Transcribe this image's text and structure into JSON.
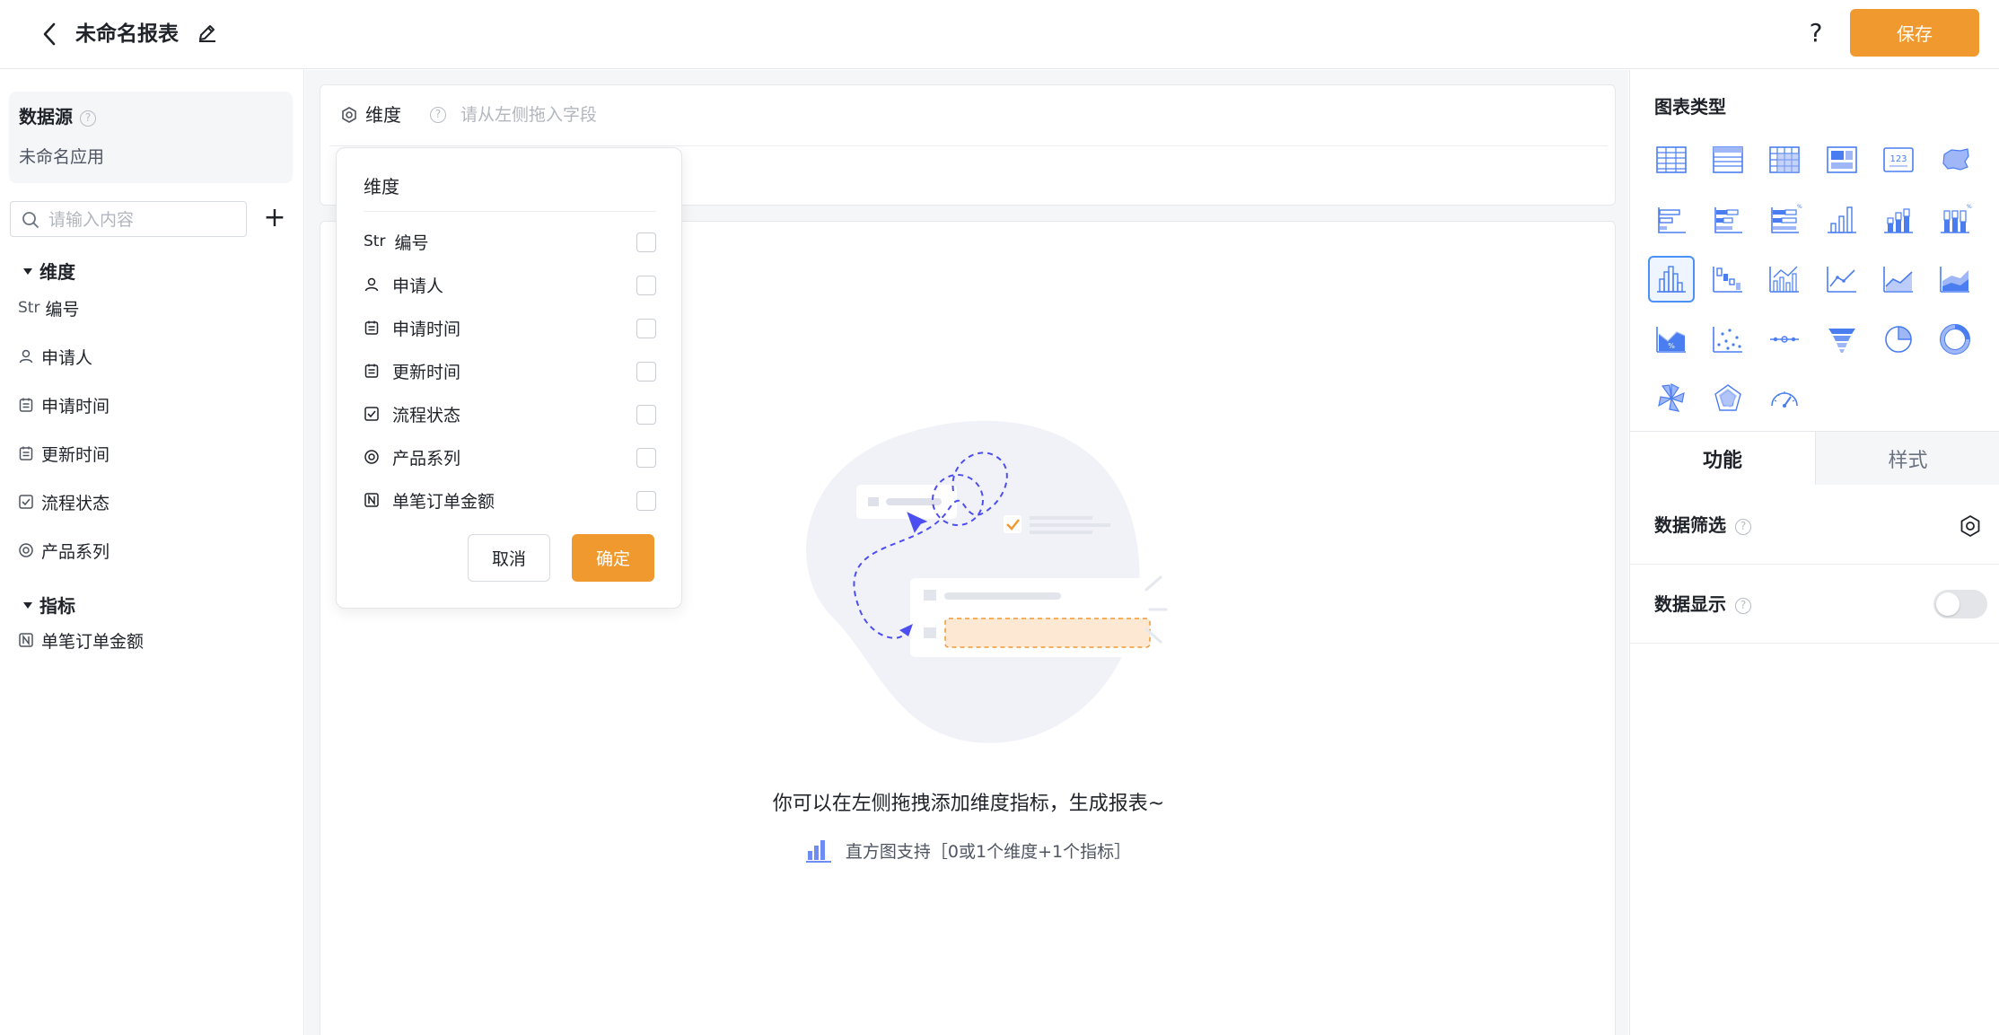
{
  "header": {
    "title": "未命名报表",
    "help_label": "?",
    "save_label": "保存"
  },
  "left": {
    "datasource_title": "数据源",
    "datasource_app": "未命名应用",
    "search_placeholder": "请输入内容",
    "add_label": "+",
    "dimension_group": "维度",
    "metric_group": "指标",
    "dimensions": [
      {
        "icon": "string-icon",
        "type_label": "Str",
        "label": "编号"
      },
      {
        "icon": "user-icon",
        "label": "申请人"
      },
      {
        "icon": "calendar-icon",
        "label": "申请时间"
      },
      {
        "icon": "calendar-icon",
        "label": "更新时间"
      },
      {
        "icon": "checkbox-icon",
        "label": "流程状态"
      },
      {
        "icon": "radio-icon",
        "label": "产品系列"
      }
    ],
    "metrics": [
      {
        "icon": "number-icon",
        "label": "单笔订单金额"
      }
    ]
  },
  "middle": {
    "dimension_label": "维度",
    "dimension_hint": "请从左侧拖入字段",
    "empty_title": "你可以在左侧拖拽添加维度指标，生成报表~",
    "empty_sub": "直方图支持［0或1个维度+1个指标］"
  },
  "popover": {
    "title": "维度",
    "items": [
      {
        "icon": "string-icon",
        "type_label": "Str",
        "label": "编号",
        "checked": false
      },
      {
        "icon": "user-icon",
        "label": "申请人",
        "checked": false
      },
      {
        "icon": "calendar-icon",
        "label": "申请时间",
        "checked": false
      },
      {
        "icon": "calendar-icon",
        "label": "更新时间",
        "checked": false
      },
      {
        "icon": "checkbox-icon",
        "label": "流程状态",
        "checked": false
      },
      {
        "icon": "radio-icon",
        "label": "产品系列",
        "checked": false
      },
      {
        "icon": "number-icon",
        "label": "单笔订单金额",
        "checked": false
      }
    ],
    "cancel_label": "取消",
    "ok_label": "确定"
  },
  "right": {
    "chart_type_title": "图表类型",
    "chart_types": [
      "table",
      "detail-table",
      "cross-table",
      "card-table",
      "indicator-card",
      "map",
      "horizontal-bar",
      "stacked-horizontal-bar",
      "percent-horizontal-bar",
      "column",
      "stacked-column",
      "percent-column",
      "histogram",
      "waterfall",
      "column-line",
      "line",
      "area",
      "stacked-area",
      "percent-area",
      "scatter",
      "dot-line",
      "funnel",
      "pie",
      "donut",
      "rose",
      "radar",
      "gauge"
    ],
    "active_chart_type": "histogram",
    "tab_function": "功能",
    "tab_style": "样式",
    "filter_label": "数据筛选",
    "display_label": "数据显示",
    "display_enabled": false
  },
  "colors": {
    "accent": "#f0992f",
    "chart_icon": "#4a7ef0",
    "active_border": "#4a90f5"
  }
}
